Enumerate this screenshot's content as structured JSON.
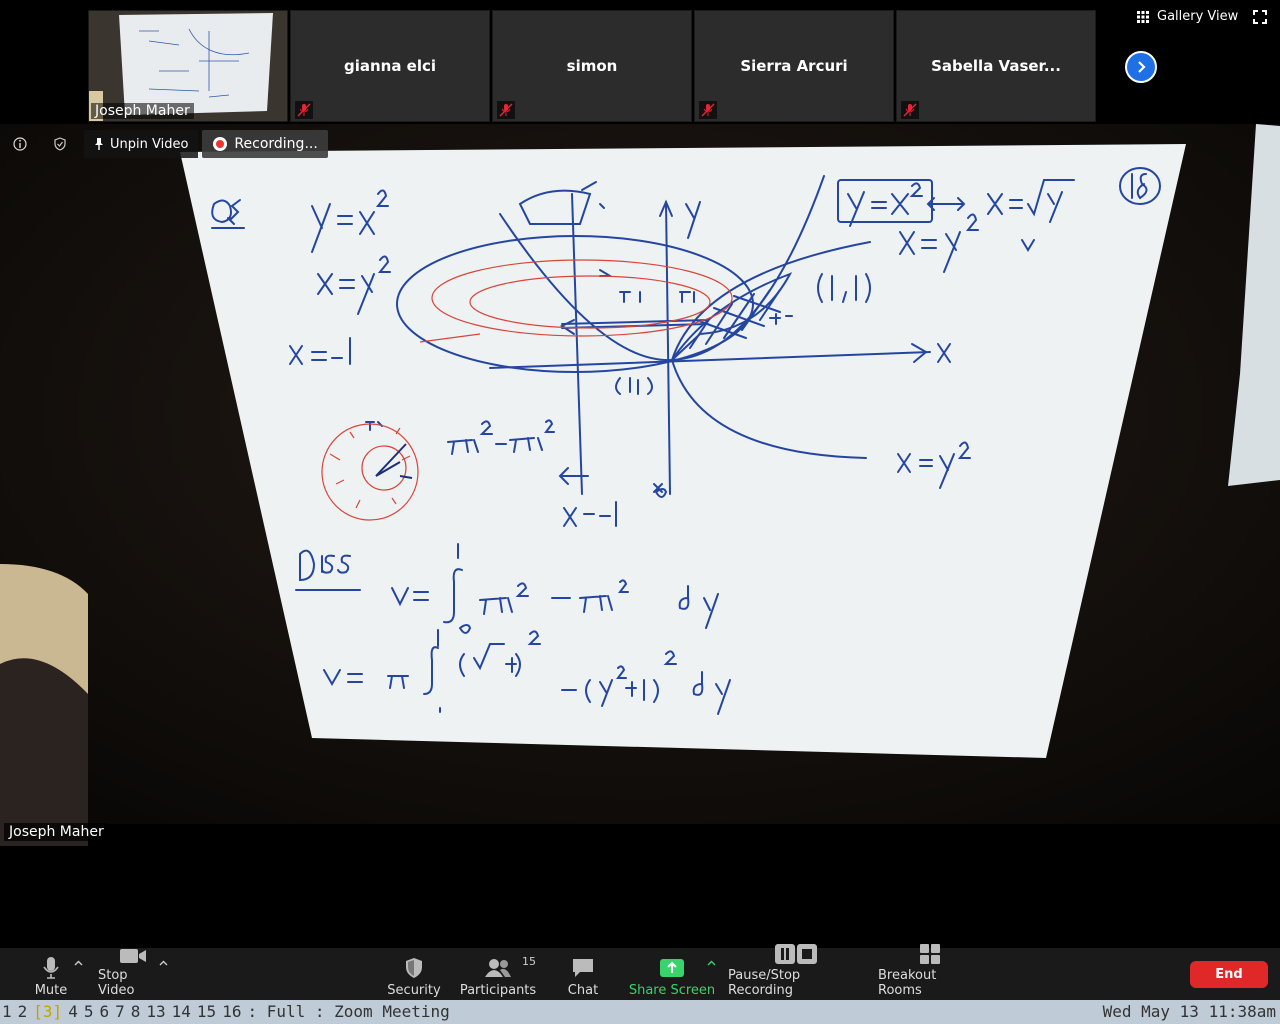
{
  "gallery": {
    "view_label": "Gallery View",
    "self_tile": {
      "name": "Joseph Maher"
    },
    "participants": [
      {
        "name": "gianna elci"
      },
      {
        "name": "simon"
      },
      {
        "name": "Sierra Arcuri"
      },
      {
        "name": "Sabella Vaser..."
      }
    ]
  },
  "main_video": {
    "name": "Joseph Maher",
    "unpin_label": "Unpin Video",
    "recording_label": "Recording..."
  },
  "toolbar": {
    "mute": "Mute",
    "stop_video": "Stop Video",
    "security": "Security",
    "participants": "Participants",
    "participants_count": "15",
    "chat": "Chat",
    "share_screen": "Share Screen",
    "pause_stop_recording": "Pause/Stop Recording",
    "breakout_rooms": "Breakout Rooms",
    "end": "End"
  },
  "statusbar": {
    "workspaces": [
      "1",
      "2",
      "[3]",
      "4",
      "5",
      "6",
      "7",
      "8",
      "13",
      "14",
      "15",
      "16"
    ],
    "active_workspace": "[3]",
    "mode": ": Full : Zoom Meeting",
    "datetime": "Wed May 13 11:38am"
  },
  "colors": {
    "toolbar_bg": "#1a1a1a",
    "tile_bg": "#2c2c2c",
    "end_button": "#e02828",
    "share_green": "#38d36a",
    "next_blue": "#1f6fe5",
    "statusbar_bg": "#bfcbd6",
    "active_workspace": "#c8a000"
  }
}
